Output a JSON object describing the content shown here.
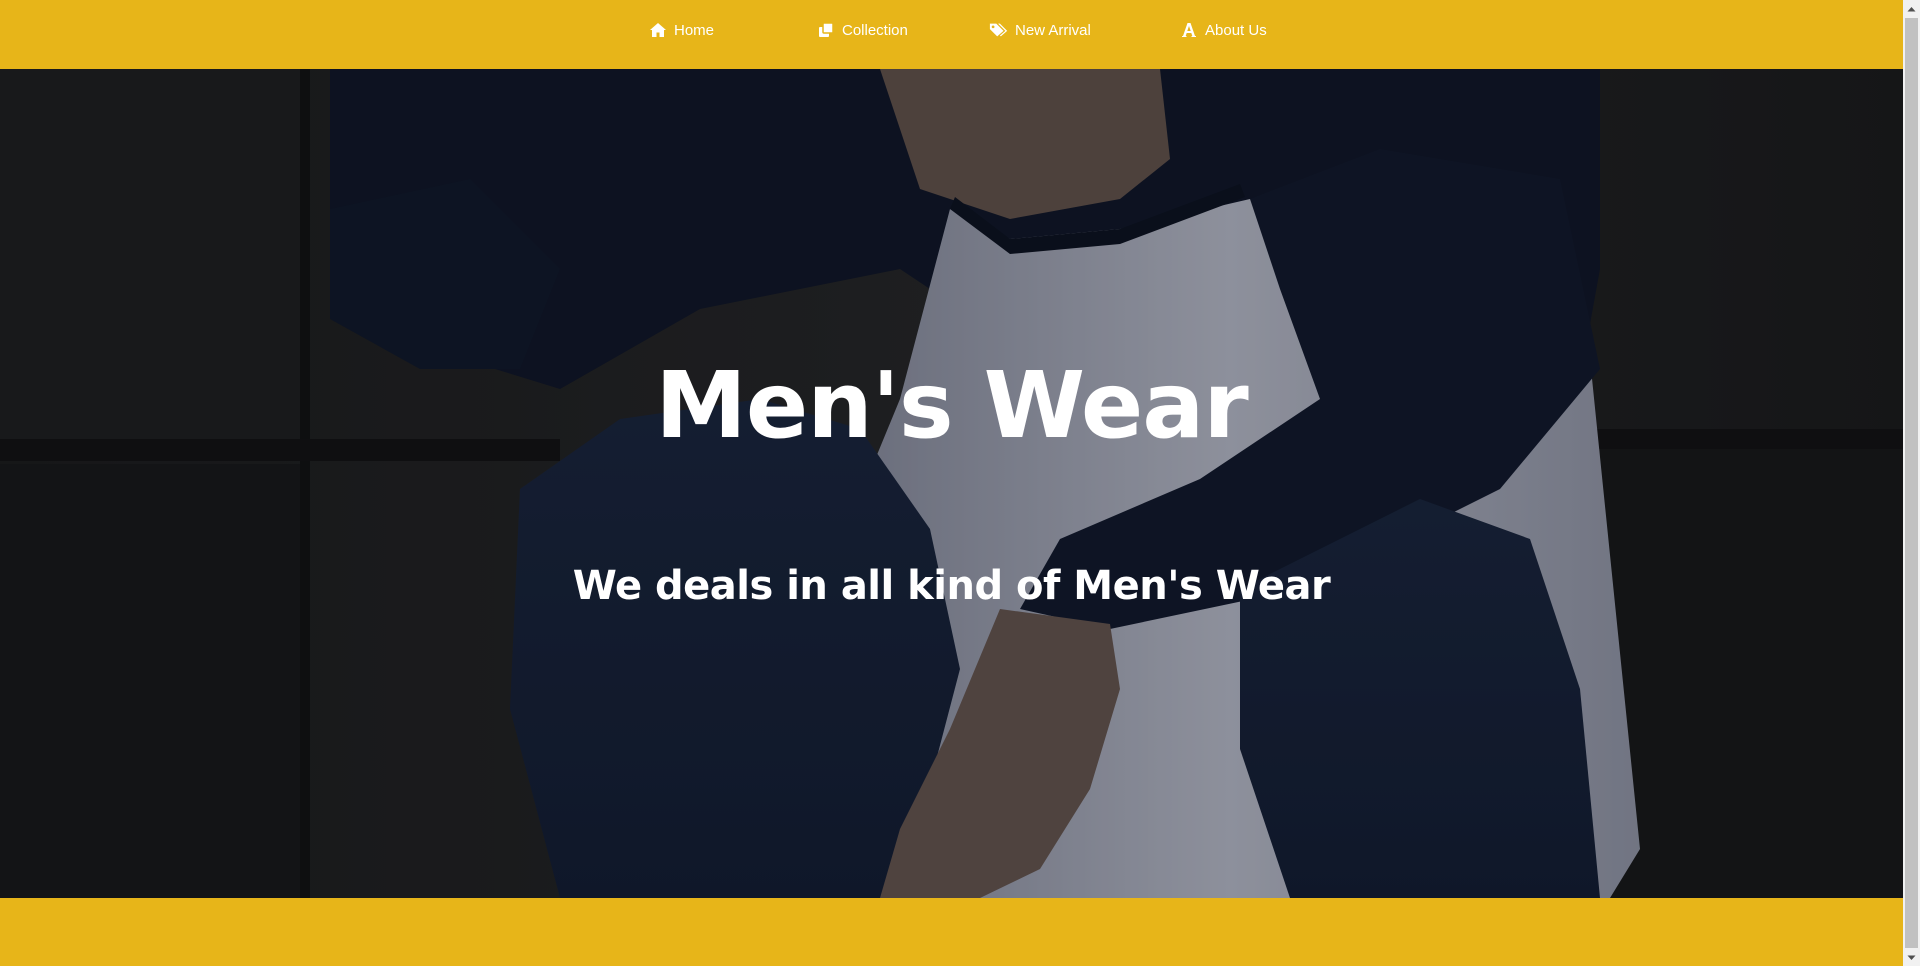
{
  "nav": {
    "items": [
      {
        "label": "Home",
        "icon": "home-icon"
      },
      {
        "label": "Collection",
        "icon": "clone-icon"
      },
      {
        "label": "New Arrival",
        "icon": "tags-icon"
      },
      {
        "label": "About Us",
        "icon": "font-icon"
      }
    ]
  },
  "hero": {
    "title": "Men's Wear",
    "subtitle": "We deals in all kind of Men's Wear"
  },
  "colors": {
    "accent": "#e7b519",
    "hero_background": "#1c1d20",
    "text": "#ffffff"
  }
}
